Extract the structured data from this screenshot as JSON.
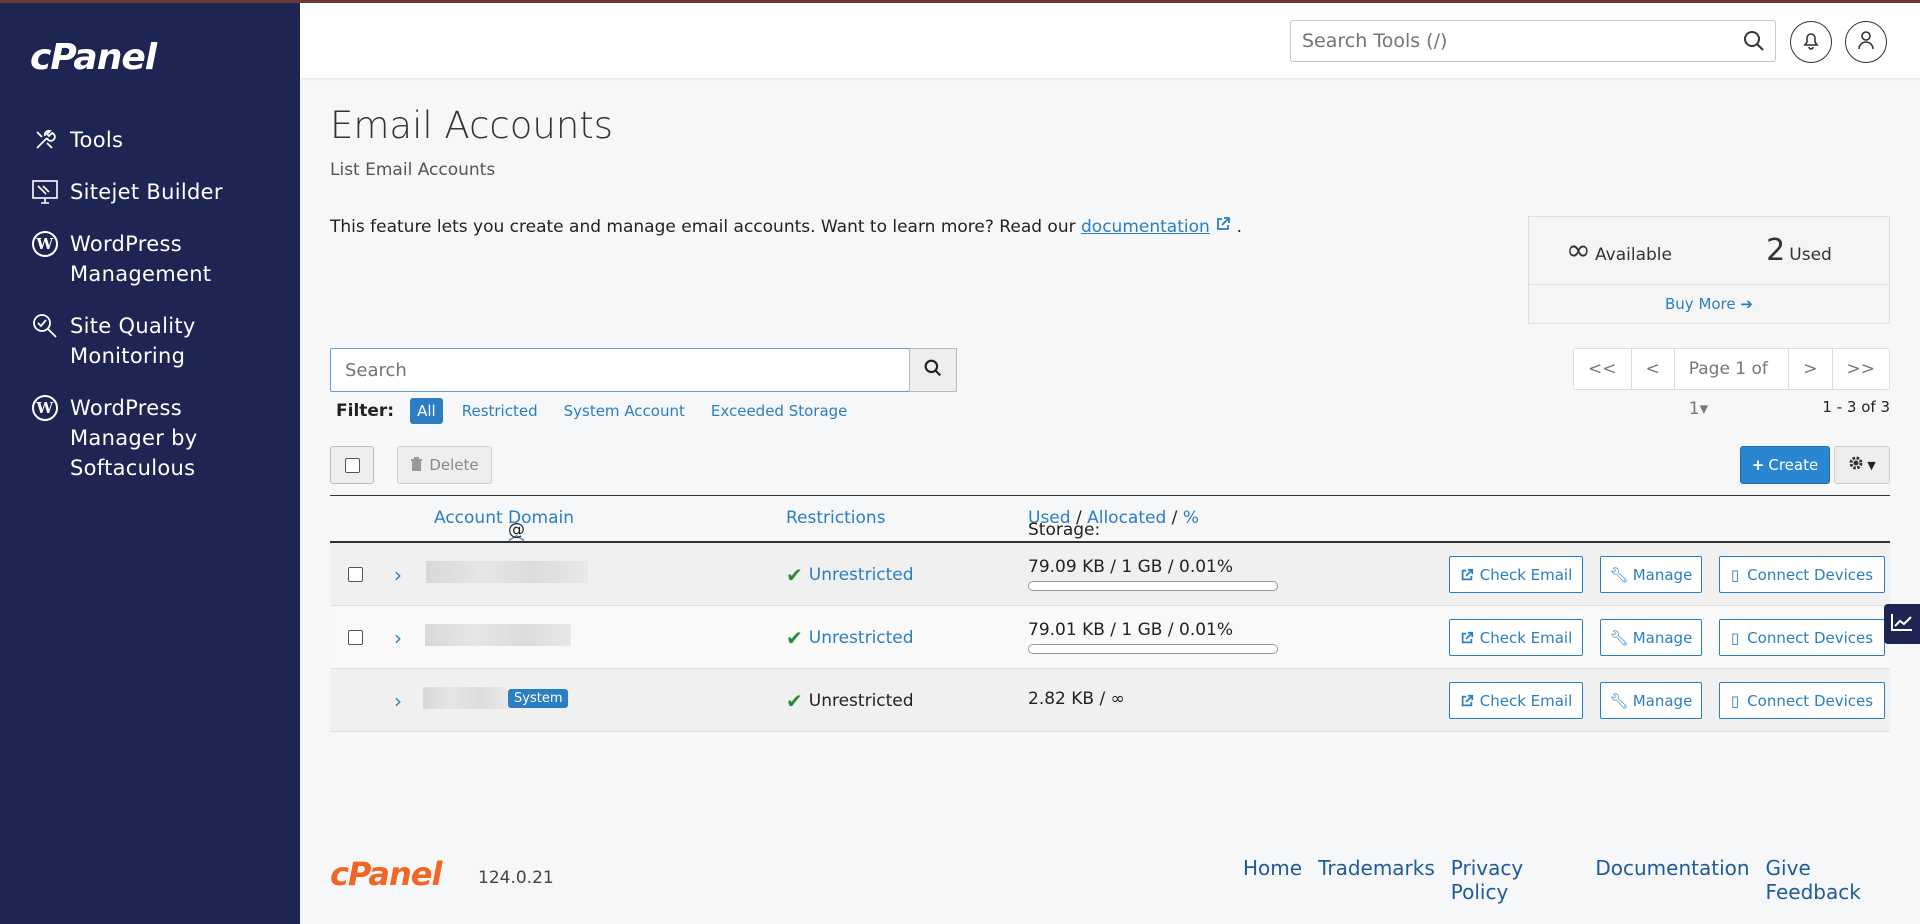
{
  "brand": {
    "logo_text": "cPanel",
    "version": "124.0.21"
  },
  "sidebar": {
    "items": [
      {
        "label": "Tools",
        "icon": "tools-icon"
      },
      {
        "label": "Sitejet Builder",
        "icon": "sitejet-icon"
      },
      {
        "label": "WordPress Management",
        "icon": "wordpress-icon"
      },
      {
        "label": "Site Quality Monitoring",
        "icon": "site-quality-icon"
      },
      {
        "label": "WordPress Manager by Softaculous",
        "icon": "wordpress-icon"
      }
    ]
  },
  "header": {
    "search_placeholder": "Search Tools (/)"
  },
  "page": {
    "title": "Email Accounts",
    "subtitle": "List Email Accounts",
    "intro_text": "This feature lets you create and manage email accounts. Want to learn more? Read our ",
    "intro_link": "documentation",
    "intro_end": "."
  },
  "stats": {
    "available_value": "∞",
    "available_label": "Available",
    "used_value": "2",
    "used_label": "Used",
    "buy_more": "Buy More"
  },
  "search": {
    "placeholder": "Search"
  },
  "pager": {
    "first": "<<",
    "prev": "<",
    "page": "Page 1 of 1",
    "next": ">",
    "last": ">>",
    "count": "1 - 3 of 3"
  },
  "filter": {
    "label": "Filter:",
    "options": [
      "All",
      "Restricted",
      "System Account",
      "Exceeded Storage"
    ],
    "active": "All"
  },
  "toolbar": {
    "delete": "Delete",
    "create": "Create"
  },
  "table": {
    "headers": {
      "account": "Account",
      "at": "@",
      "domain": "Domain",
      "restrictions": "Restrictions",
      "storage": "Storage:",
      "used": "Used",
      "allocated": "Allocated",
      "percent": "%"
    },
    "rows": [
      {
        "restriction": "Unrestricted",
        "storage": "79.09 KB / 1 GB / 0.01%",
        "used_fraction": 0.0001
      },
      {
        "restriction": "Unrestricted",
        "storage": "79.01 KB / 1 GB / 0.01%",
        "used_fraction": 0.0001
      },
      {
        "restriction": "Unrestricted",
        "storage": "2.82 KB / ∞",
        "badge": "System"
      }
    ],
    "actions": {
      "check_email": "Check Email",
      "manage": "Manage",
      "connect_devices": "Connect Devices"
    }
  },
  "footer": {
    "links": [
      "Home",
      "Trademarks",
      "Privacy Policy",
      "Documentation",
      "Give Feedback"
    ]
  }
}
